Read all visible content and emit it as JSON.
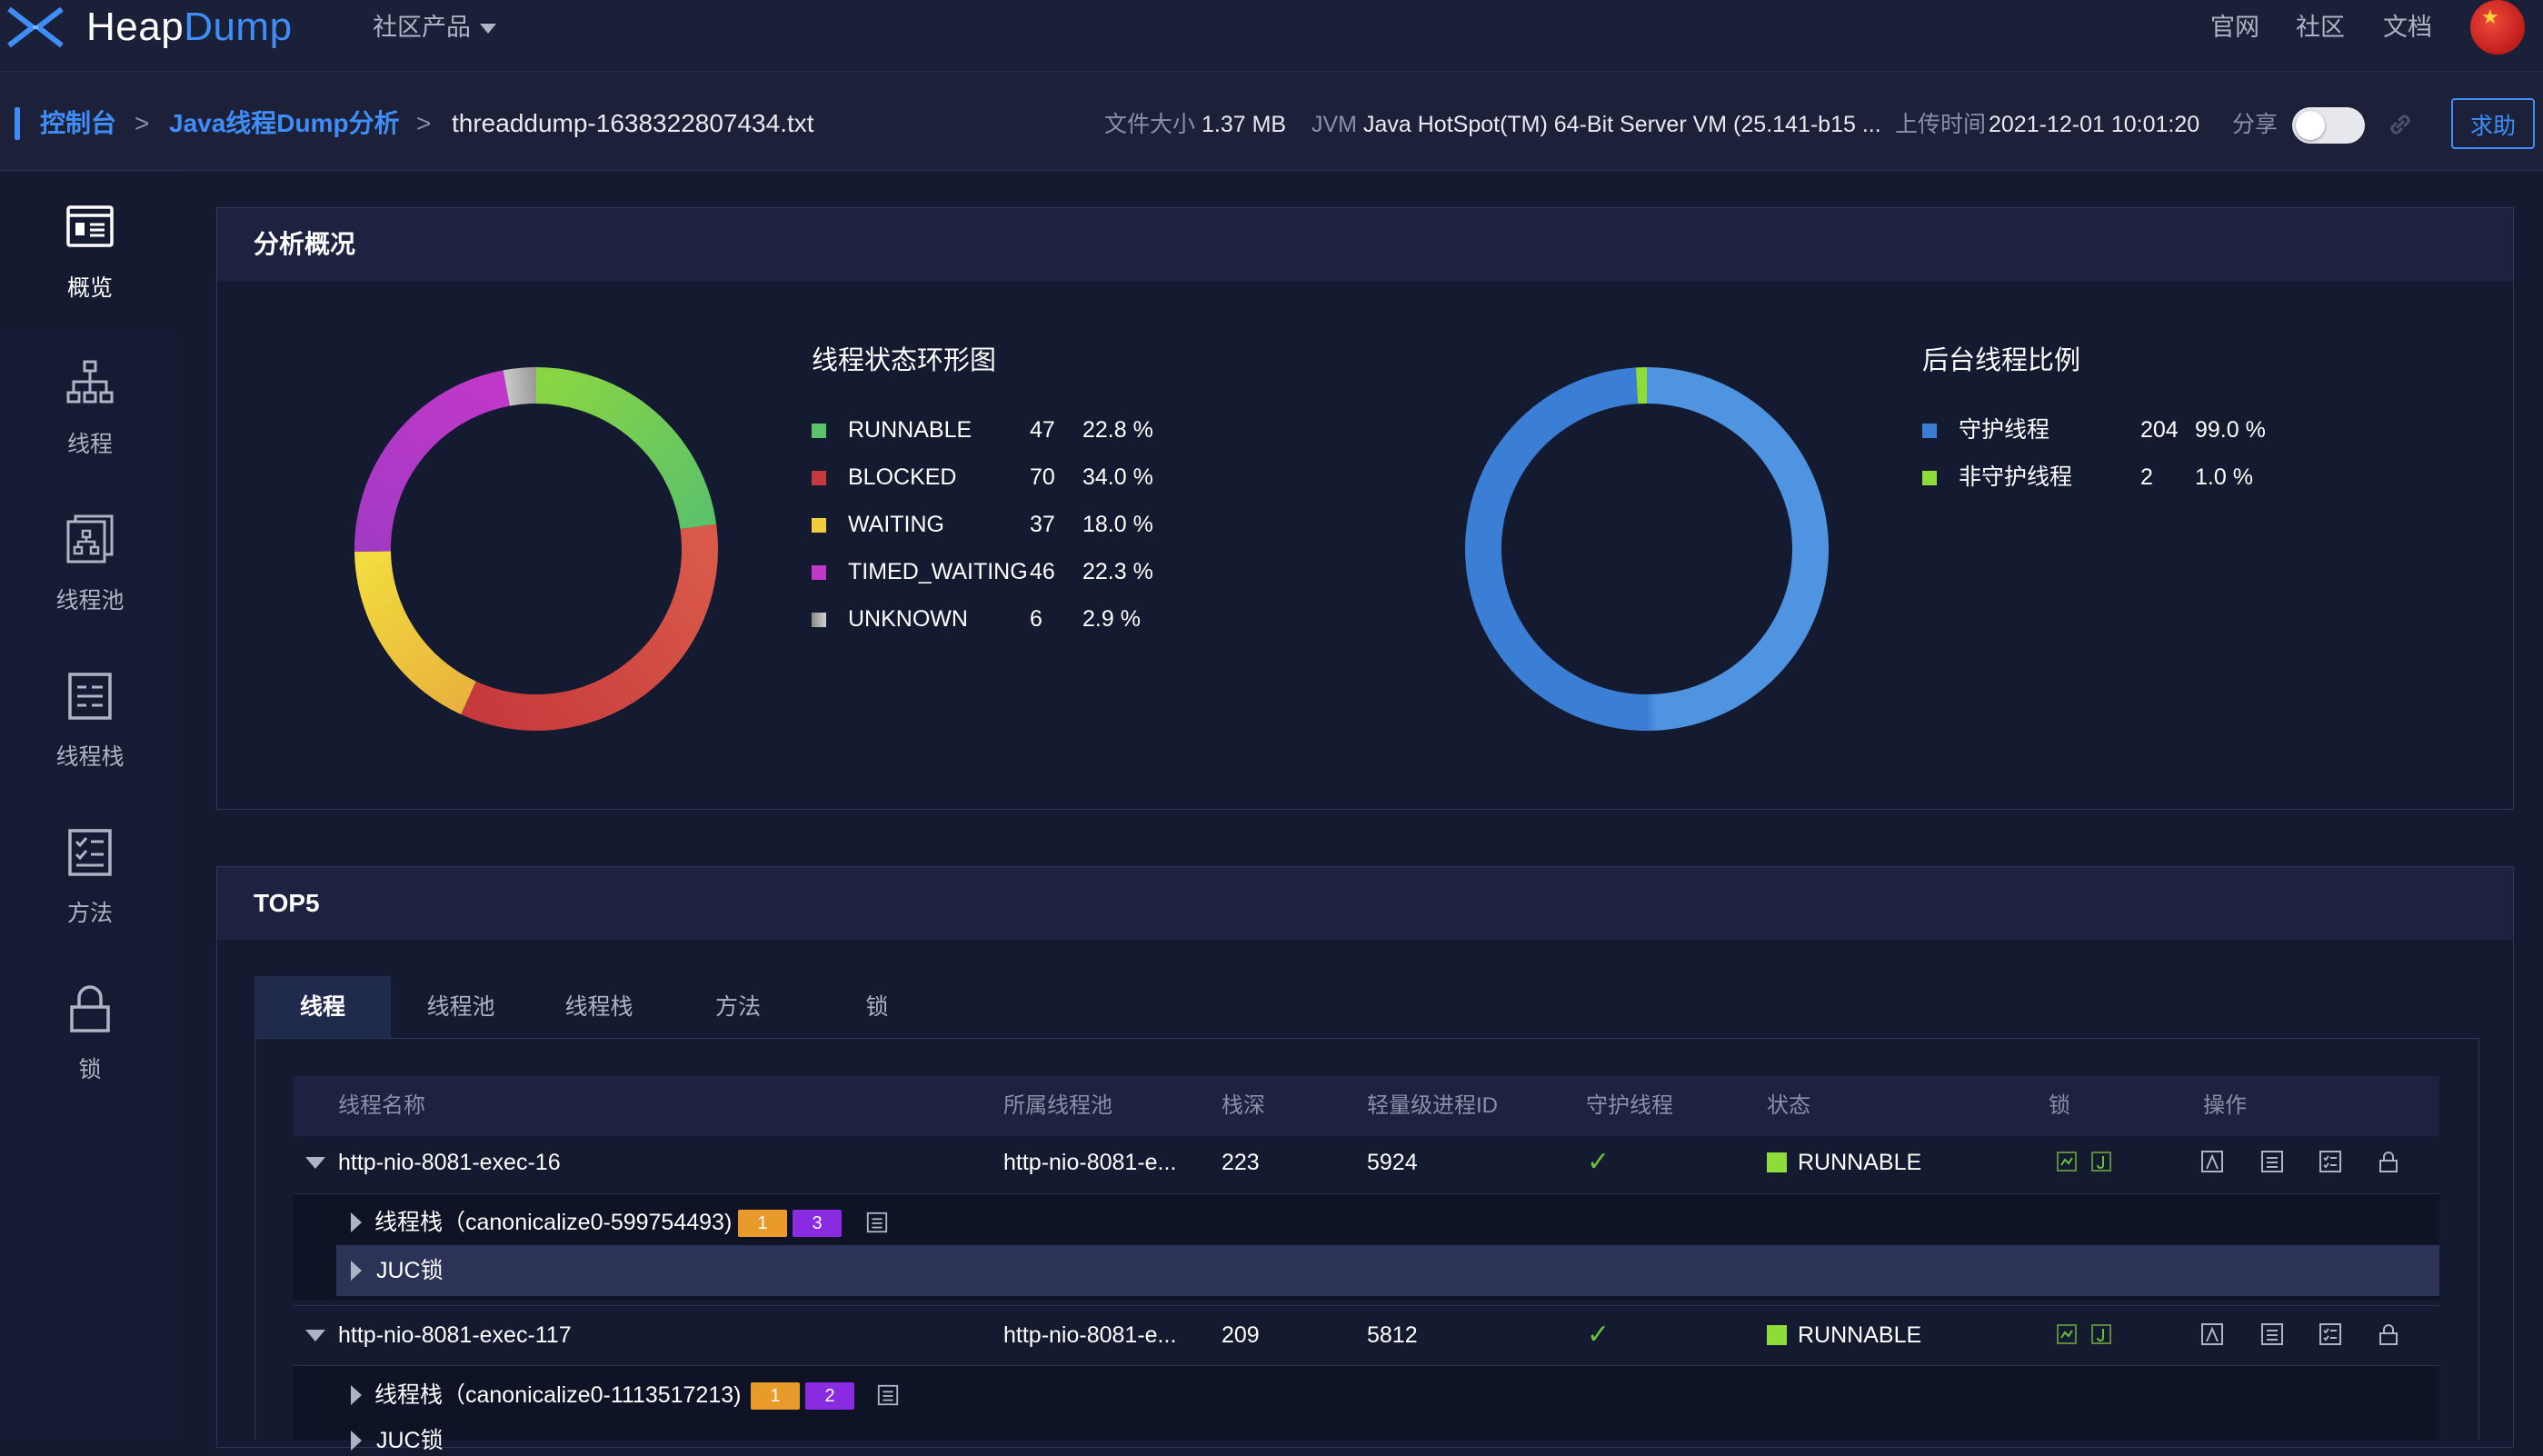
{
  "header": {
    "brand_a": "Heap",
    "brand_b": "Dump",
    "community_menu": "社区产品",
    "links": [
      "官网",
      "社区",
      "文档"
    ]
  },
  "breadcrumb": {
    "console": "控制台",
    "sep": ">",
    "analysis": "Java线程Dump分析",
    "file": "threaddump-1638322807434.txt"
  },
  "file_meta": {
    "size_label": "文件大小",
    "size_value": "1.37 MB",
    "jvm_label": "JVM",
    "jvm_value": "Java HotSpot(TM) 64-Bit Server VM (25.141-b15 ...",
    "upload_label": "上传时间",
    "upload_value": "2021-12-01 10:01:20",
    "share_label": "分享",
    "share_on": false,
    "help_label": "求助"
  },
  "sidebar": {
    "items": [
      {
        "label": "概览",
        "icon": "overview-icon",
        "active": true
      },
      {
        "label": "线程",
        "icon": "thread-tree-icon",
        "active": false
      },
      {
        "label": "线程池",
        "icon": "thread-pool-icon",
        "active": false
      },
      {
        "label": "线程栈",
        "icon": "thread-stack-icon",
        "active": false
      },
      {
        "label": "方法",
        "icon": "method-checklist-icon",
        "active": false
      },
      {
        "label": "锁",
        "icon": "lock-icon",
        "active": false
      }
    ]
  },
  "overview": {
    "title": "分析概况"
  },
  "chart_data": [
    {
      "type": "pie",
      "donut": true,
      "title": "线程状态环形图",
      "legend_position": "right",
      "slices": [
        {
          "name": "RUNNABLE",
          "count": 47,
          "percent": "22.8 %",
          "color": "#5cc26a",
          "color_b": "#8ad642"
        },
        {
          "name": "BLOCKED",
          "count": 70,
          "percent": "34.0 %",
          "color": "#c6393c",
          "color_b": "#d95a4a"
        },
        {
          "name": "WAITING",
          "count": 37,
          "percent": "18.0 %",
          "color": "#f2dc3f",
          "color_b": "#e9b33d"
        },
        {
          "name": "TIMED_WAITING",
          "count": 46,
          "percent": "22.3 %",
          "color": "#c238c8",
          "color_b": "#a23ac4"
        },
        {
          "name": "UNKNOWN",
          "count": 6,
          "percent": "2.9 %",
          "color": "#9a9a9a",
          "color_b": "#c8c8c8"
        }
      ]
    },
    {
      "type": "pie",
      "donut": true,
      "title": "后台线程比例",
      "legend_position": "right",
      "slices": [
        {
          "name": "守护线程",
          "count": 204,
          "percent": "99.0 %",
          "color": "#3b7ed6",
          "color_b": "#4f94e0"
        },
        {
          "name": "非守护线程",
          "count": 2,
          "percent": "1.0 %",
          "color": "#8ddc3a",
          "color_b": "#8ddc3a"
        }
      ]
    }
  ],
  "top5": {
    "title": "TOP5",
    "tabs": [
      "线程",
      "线程池",
      "线程栈",
      "方法",
      "锁"
    ],
    "active_tab": 0,
    "columns": [
      "线程名称",
      "所属线程池",
      "栈深",
      "轻量级进程ID",
      "守护线程",
      "状态",
      "锁",
      "操作"
    ],
    "rows": [
      {
        "name": "http-nio-8081-exec-16",
        "pool": "http-nio-8081-e...",
        "depth": "223",
        "lwp": "5924",
        "daemon": "✓",
        "state": "RUNNABLE",
        "stack": "线程栈（canonicalize0-599754493)",
        "badge_a": "1",
        "badge_b": "3",
        "juc": "JUC锁"
      },
      {
        "name": "http-nio-8081-exec-117",
        "pool": "http-nio-8081-e...",
        "depth": "209",
        "lwp": "5812",
        "daemon": "✓",
        "state": "RUNNABLE",
        "stack": "线程栈（canonicalize0-1113517213)",
        "badge_a": "1",
        "badge_b": "2",
        "juc": "JUC锁"
      }
    ]
  }
}
